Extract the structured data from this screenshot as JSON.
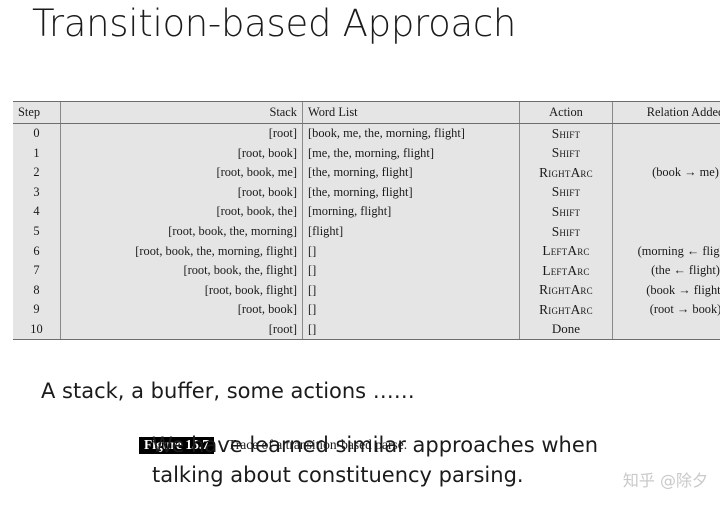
{
  "slide": {
    "title": "Transition-based Approach"
  },
  "figure": {
    "columns": {
      "step": "Step",
      "stack": "Stack",
      "word_list": "Word List",
      "action": "Action",
      "relation": "Relation Added"
    },
    "rows": [
      {
        "step": "0",
        "stack": "[root]",
        "words": "[book, me, the, morning, flight]",
        "action": "Shift",
        "relation": ""
      },
      {
        "step": "1",
        "stack": "[root, book]",
        "words": "[me, the, morning, flight]",
        "action": "Shift",
        "relation": ""
      },
      {
        "step": "2",
        "stack": "[root, book, me]",
        "words": "[the, morning, flight]",
        "action": "RightArc",
        "relation": "(book → me)"
      },
      {
        "step": "3",
        "stack": "[root, book]",
        "words": "[the, morning, flight]",
        "action": "Shift",
        "relation": ""
      },
      {
        "step": "4",
        "stack": "[root, book, the]",
        "words": "[morning, flight]",
        "action": "Shift",
        "relation": ""
      },
      {
        "step": "5",
        "stack": "[root, book, the, morning]",
        "words": "[flight]",
        "action": "Shift",
        "relation": ""
      },
      {
        "step": "6",
        "stack": "[root, book, the, morning, flight]",
        "words": "[]",
        "action": "LeftArc",
        "relation": "(morning ← flight)"
      },
      {
        "step": "7",
        "stack": "[root, book, the, flight]",
        "words": "[]",
        "action": "LeftArc",
        "relation": "(the ← flight)"
      },
      {
        "step": "8",
        "stack": "[root, book, flight]",
        "words": "[]",
        "action": "RightArc",
        "relation": "(book → flight)"
      },
      {
        "step": "9",
        "stack": "[root, book]",
        "words": "[]",
        "action": "RightArc",
        "relation": "(root → book)"
      },
      {
        "step": "10",
        "stack": "[root]",
        "words": "[]",
        "action": "Done",
        "relation": ""
      }
    ],
    "caption": {
      "badge": "Figure 15.7",
      "text": "Trace of a transition-based parse."
    }
  },
  "body": {
    "line1": "A stack, a buffer, some actions ……",
    "line2_a": "We have learned similar approaches when",
    "line2_b": "talking about constituency parsing."
  },
  "watermark": {
    "text": "知乎 @除夕"
  },
  "colors": {
    "page_background": "#ffffff",
    "table_background": "#e5e5e5",
    "rule": "#6d6d6d",
    "text": "#1a1a1a",
    "badge_background": "#000000",
    "watermark": "#c9c9c9"
  }
}
